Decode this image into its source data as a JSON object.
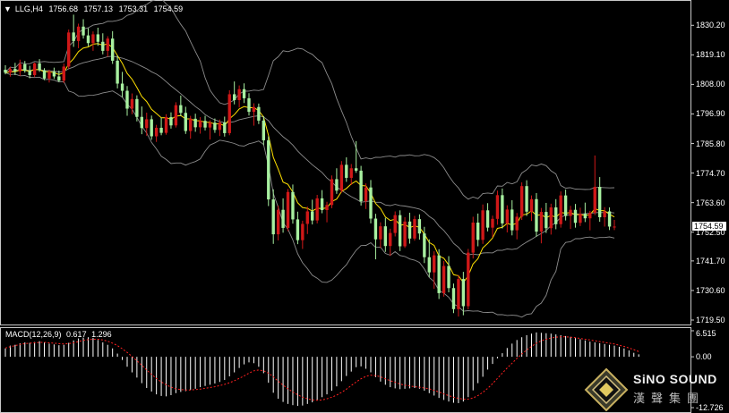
{
  "header": {
    "arrow": "▼",
    "symbol": "LLG,H4",
    "open": "1756.68",
    "high": "1757.13",
    "low": "1753.31",
    "close": "1754.59"
  },
  "price_axis": {
    "ticks": [
      "1830.20",
      "1819.10",
      "1808.00",
      "1796.90",
      "1785.80",
      "1774.70",
      "1763.60",
      "1752.50",
      "1741.70",
      "1730.60",
      "1719.50"
    ],
    "current_price": "1754.59"
  },
  "macd": {
    "label": "MACD(12,26,9)",
    "main": "0.617",
    "signal": "1.296",
    "ticks": [
      "6.515",
      "0.00",
      "-12.726"
    ]
  },
  "logo": {
    "name": "SiNO SOUND",
    "chinese": "漢聲集團"
  },
  "colors": {
    "bull": "#d01818",
    "bear": "#a8f0a0",
    "bands": "#8c8c8c",
    "ma": "#ffe000",
    "macd_hist": "#ffffff",
    "macd_signal": "#ff2020"
  },
  "chart_data": {
    "type": "candlestick",
    "symbol": "LLG",
    "timeframe": "H4",
    "ylim": [
      1719.5,
      1835
    ],
    "macd_ylim": [
      -12.726,
      6.515
    ],
    "candles": [
      [
        1813.5,
        1815.2,
        1811.8,
        1812.4
      ],
      [
        1812.4,
        1814.6,
        1810.9,
        1813.8
      ],
      [
        1813.8,
        1816.1,
        1811.5,
        1812.9
      ],
      [
        1812.9,
        1817.3,
        1811.2,
        1815.6
      ],
      [
        1815.6,
        1816.8,
        1812.4,
        1813.1
      ],
      [
        1813.1,
        1815.0,
        1810.3,
        1811.5
      ],
      [
        1811.5,
        1816.2,
        1810.8,
        1815.9
      ],
      [
        1815.9,
        1817.5,
        1812.7,
        1813.3
      ],
      [
        1813.3,
        1814.1,
        1809.6,
        1810.2
      ],
      [
        1810.2,
        1813.5,
        1808.7,
        1812.8
      ],
      [
        1812.8,
        1814.3,
        1810.1,
        1811.0
      ],
      [
        1811.0,
        1813.2,
        1808.9,
        1809.4
      ],
      [
        1809.4,
        1815.8,
        1808.5,
        1814.7
      ],
      [
        1814.7,
        1828.6,
        1813.9,
        1827.5
      ],
      [
        1827.5,
        1834.2,
        1822.1,
        1824.3
      ],
      [
        1824.3,
        1830.8,
        1821.6,
        1829.7
      ],
      [
        1829.7,
        1832.5,
        1825.2,
        1826.4
      ],
      [
        1826.4,
        1829.1,
        1822.3,
        1823.5
      ],
      [
        1823.5,
        1827.9,
        1820.6,
        1826.8
      ],
      [
        1826.8,
        1829.3,
        1822.5,
        1824.0
      ],
      [
        1824.0,
        1827.2,
        1819.3,
        1820.6
      ],
      [
        1820.6,
        1826.1,
        1818.4,
        1825.2
      ],
      [
        1825.2,
        1828.0,
        1815.7,
        1816.9
      ],
      [
        1816.9,
        1818.8,
        1806.5,
        1808.3
      ],
      [
        1808.3,
        1812.7,
        1803.2,
        1805.6
      ],
      [
        1805.6,
        1807.4,
        1796.2,
        1798.9
      ],
      [
        1798.9,
        1804.6,
        1796.8,
        1802.5
      ],
      [
        1802.5,
        1803.9,
        1794.1,
        1795.8
      ],
      [
        1795.8,
        1799.7,
        1789.3,
        1791.6
      ],
      [
        1791.6,
        1797.4,
        1788.7,
        1794.9
      ],
      [
        1794.9,
        1796.3,
        1787.2,
        1788.5
      ],
      [
        1788.5,
        1792.8,
        1786.4,
        1791.7
      ],
      [
        1791.7,
        1795.5,
        1788.9,
        1789.8
      ],
      [
        1789.8,
        1796.8,
        1789.1,
        1795.7
      ],
      [
        1795.7,
        1797.5,
        1791.4,
        1792.6
      ],
      [
        1792.6,
        1801.3,
        1791.8,
        1800.2
      ],
      [
        1800.2,
        1803.8,
        1796.1,
        1797.3
      ],
      [
        1797.3,
        1799.6,
        1789.4,
        1790.5
      ],
      [
        1790.5,
        1796.2,
        1787.6,
        1795.1
      ],
      [
        1795.1,
        1797.0,
        1790.2,
        1791.9
      ],
      [
        1791.9,
        1795.7,
        1789.5,
        1794.3
      ],
      [
        1794.3,
        1796.2,
        1790.7,
        1791.8
      ],
      [
        1791.8,
        1794.5,
        1787.3,
        1793.6
      ],
      [
        1793.6,
        1795.2,
        1789.8,
        1790.9
      ],
      [
        1790.9,
        1794.8,
        1788.6,
        1793.7
      ],
      [
        1793.7,
        1795.9,
        1788.4,
        1789.7
      ],
      [
        1789.7,
        1805.8,
        1788.9,
        1804.3
      ],
      [
        1804.3,
        1809.1,
        1800.5,
        1802.1
      ],
      [
        1802.1,
        1807.6,
        1799.3,
        1806.2
      ],
      [
        1806.2,
        1808.4,
        1801.0,
        1802.8
      ],
      [
        1802.8,
        1804.7,
        1796.3,
        1797.7
      ],
      [
        1797.7,
        1800.9,
        1792.5,
        1799.5
      ],
      [
        1799.5,
        1800.8,
        1793.1,
        1794.4
      ],
      [
        1794.4,
        1796.1,
        1785.2,
        1787.0
      ],
      [
        1787.0,
        1788.5,
        1762.3,
        1764.8
      ],
      [
        1764.8,
        1768.6,
        1748.1,
        1751.7
      ],
      [
        1751.7,
        1762.5,
        1749.4,
        1760.9
      ],
      [
        1760.9,
        1765.2,
        1752.3,
        1754.1
      ],
      [
        1754.1,
        1768.7,
        1752.9,
        1767.6
      ],
      [
        1767.6,
        1770.4,
        1755.7,
        1757.3
      ],
      [
        1757.3,
        1760.2,
        1748.0,
        1749.5
      ],
      [
        1749.5,
        1756.8,
        1746.2,
        1755.6
      ],
      [
        1755.6,
        1762.1,
        1751.8,
        1760.3
      ],
      [
        1760.3,
        1764.7,
        1755.4,
        1756.9
      ],
      [
        1756.9,
        1766.5,
        1755.8,
        1765.2
      ],
      [
        1765.2,
        1768.3,
        1759.6,
        1760.8
      ],
      [
        1760.8,
        1763.9,
        1756.2,
        1762.7
      ],
      [
        1762.7,
        1773.8,
        1761.5,
        1772.4
      ],
      [
        1772.4,
        1776.5,
        1766.9,
        1768.1
      ],
      [
        1768.1,
        1779.2,
        1767.3,
        1777.8
      ],
      [
        1777.8,
        1780.6,
        1771.4,
        1772.9
      ],
      [
        1772.9,
        1778.1,
        1770.2,
        1776.5
      ],
      [
        1776.5,
        1786.7,
        1774.8,
        1775.6
      ],
      [
        1775.6,
        1777.4,
        1762.5,
        1764.1
      ],
      [
        1764.1,
        1770.8,
        1761.2,
        1769.3
      ],
      [
        1769.3,
        1772.1,
        1755.8,
        1757.6
      ],
      [
        1757.6,
        1759.4,
        1742.3,
        1749.8
      ],
      [
        1749.8,
        1756.2,
        1746.5,
        1754.7
      ],
      [
        1754.7,
        1757.9,
        1745.1,
        1747.3
      ],
      [
        1747.3,
        1753.8,
        1743.6,
        1752.2
      ],
      [
        1752.2,
        1760.3,
        1750.9,
        1758.9
      ],
      [
        1758.9,
        1760.7,
        1745.4,
        1747.2
      ],
      [
        1747.2,
        1758.1,
        1746.6,
        1756.5
      ],
      [
        1756.5,
        1759.8,
        1748.2,
        1750.1
      ],
      [
        1750.1,
        1758.6,
        1749.3,
        1757.4
      ],
      [
        1757.4,
        1759.2,
        1749.7,
        1752.0
      ],
      [
        1752.0,
        1754.5,
        1740.9,
        1743.1
      ],
      [
        1743.1,
        1749.8,
        1735.6,
        1737.4
      ],
      [
        1737.4,
        1745.3,
        1731.2,
        1743.8
      ],
      [
        1743.8,
        1746.1,
        1727.4,
        1729.6
      ],
      [
        1729.6,
        1741.7,
        1728.3,
        1739.8
      ],
      [
        1739.8,
        1743.5,
        1729.9,
        1731.5
      ],
      [
        1731.5,
        1733.2,
        1722.1,
        1723.6
      ],
      [
        1723.6,
        1736.4,
        1720.8,
        1734.9
      ],
      [
        1734.9,
        1737.6,
        1721.3,
        1724.7
      ],
      [
        1724.7,
        1746.2,
        1723.5,
        1744.8
      ],
      [
        1744.8,
        1758.3,
        1742.6,
        1756.1
      ],
      [
        1756.1,
        1759.5,
        1747.2,
        1749.6
      ],
      [
        1749.6,
        1762.9,
        1748.1,
        1760.7
      ],
      [
        1760.7,
        1763.4,
        1752.8,
        1754.2
      ],
      [
        1754.2,
        1758.7,
        1750.6,
        1757.5
      ],
      [
        1757.5,
        1768.1,
        1755.3,
        1766.4
      ],
      [
        1766.4,
        1768.9,
        1753.9,
        1755.8
      ],
      [
        1755.8,
        1762.6,
        1752.4,
        1761.0
      ],
      [
        1761.0,
        1764.5,
        1751.3,
        1753.2
      ],
      [
        1753.2,
        1759.7,
        1749.8,
        1758.3
      ],
      [
        1758.3,
        1771.2,
        1757.1,
        1769.8
      ],
      [
        1769.8,
        1772.0,
        1758.6,
        1760.2
      ],
      [
        1760.2,
        1766.3,
        1756.7,
        1764.9
      ],
      [
        1764.9,
        1767.2,
        1750.8,
        1752.7
      ],
      [
        1752.7,
        1761.6,
        1748.3,
        1760.1
      ],
      [
        1760.1,
        1763.5,
        1752.2,
        1754.0
      ],
      [
        1754.0,
        1763.2,
        1751.6,
        1761.8
      ],
      [
        1761.8,
        1764.9,
        1753.6,
        1755.5
      ],
      [
        1755.5,
        1767.8,
        1754.2,
        1766.3
      ],
      [
        1766.3,
        1768.5,
        1756.9,
        1758.6
      ],
      [
        1758.6,
        1762.4,
        1753.7,
        1760.9
      ],
      [
        1760.9,
        1763.1,
        1754.2,
        1756.0
      ],
      [
        1756.0,
        1761.7,
        1754.8,
        1759.4
      ],
      [
        1759.4,
        1763.6,
        1756.3,
        1757.7
      ],
      [
        1757.7,
        1760.5,
        1753.2,
        1759.8
      ],
      [
        1759.8,
        1781.3,
        1758.9,
        1769.5
      ],
      [
        1769.5,
        1773.2,
        1756.4,
        1758.1
      ],
      [
        1758.1,
        1761.9,
        1754.6,
        1760.3
      ],
      [
        1760.3,
        1761.8,
        1753.3,
        1754.6
      ],
      [
        1754.6,
        1757.1,
        1753.3,
        1754.6
      ]
    ],
    "macd_hist": [
      2.1,
      2.8,
      3.0,
      3.4,
      3.6,
      3.5,
      3.7,
      3.9,
      3.6,
      3.3,
      3.1,
      2.9,
      3.0,
      3.5,
      4.1,
      4.6,
      4.8,
      4.9,
      4.7,
      4.2,
      3.6,
      3.0,
      2.1,
      0.8,
      -0.8,
      -2.5,
      -3.9,
      -5.2,
      -6.6,
      -7.8,
      -8.7,
      -9.4,
      -9.8,
      -9.9,
      -9.6,
      -9.1,
      -8.8,
      -8.6,
      -8.3,
      -8.0,
      -7.6,
      -7.3,
      -7.0,
      -6.7,
      -6.3,
      -5.8,
      -4.9,
      -3.9,
      -2.8,
      -1.9,
      -1.4,
      -1.6,
      -2.5,
      -4.1,
      -6.5,
      -9.0,
      -10.5,
      -11.3,
      -11.8,
      -12.1,
      -12.3,
      -12.2,
      -11.8,
      -11.4,
      -10.8,
      -10.1,
      -9.4,
      -8.5,
      -7.4,
      -6.1,
      -4.8,
      -3.7,
      -2.6,
      -2.4,
      -3.0,
      -3.9,
      -5.1,
      -6.2,
      -7.0,
      -7.6,
      -7.9,
      -8.1,
      -8.0,
      -7.9,
      -7.8,
      -8.0,
      -8.5,
      -9.1,
      -9.7,
      -10.3,
      -10.8,
      -11.2,
      -11.5,
      -11.6,
      -11.2,
      -10.1,
      -8.4,
      -6.6,
      -5.0,
      -3.2,
      -1.8,
      -0.4,
      0.9,
      2.2,
      3.3,
      4.2,
      4.9,
      5.4,
      5.8,
      6.1,
      6.0,
      5.9,
      5.8,
      5.6,
      5.4,
      5.2,
      5.0,
      4.7,
      4.4,
      4.1,
      3.8,
      3.6,
      3.4,
      3.2,
      3.0,
      2.8,
      2.5,
      2.1,
      1.6,
      1.0,
      0.617
    ],
    "macd_signal": [
      2.2,
      2.5,
      2.8,
      3.1,
      3.3,
      3.4,
      3.5,
      3.6,
      3.6,
      3.5,
      3.4,
      3.3,
      3.2,
      3.3,
      3.5,
      3.8,
      4.1,
      4.3,
      4.4,
      4.4,
      4.2,
      3.9,
      3.4,
      2.8,
      2.0,
      1.1,
      0.1,
      -1.0,
      -2.1,
      -3.3,
      -4.4,
      -5.4,
      -6.3,
      -7.0,
      -7.6,
      -8.0,
      -8.2,
      -8.3,
      -8.3,
      -8.2,
      -8.1,
      -7.9,
      -7.7,
      -7.5,
      -7.2,
      -6.9,
      -6.5,
      -6.0,
      -5.4,
      -4.8,
      -4.1,
      -3.5,
      -3.3,
      -3.5,
      -4.1,
      -5.0,
      -6.1,
      -7.1,
      -8.0,
      -8.8,
      -9.5,
      -10.1,
      -10.5,
      -10.8,
      -10.9,
      -10.8,
      -10.5,
      -10.1,
      -9.6,
      -8.9,
      -8.1,
      -7.2,
      -6.3,
      -5.5,
      -4.9,
      -4.6,
      -4.7,
      -5.0,
      -5.5,
      -6.0,
      -6.4,
      -6.8,
      -7.1,
      -7.3,
      -7.5,
      -7.6,
      -7.8,
      -8.0,
      -8.4,
      -8.8,
      -9.3,
      -9.7,
      -10.1,
      -10.4,
      -10.6,
      -10.6,
      -10.3,
      -9.7,
      -8.9,
      -7.9,
      -6.7,
      -5.4,
      -4.1,
      -2.8,
      -1.6,
      -0.4,
      0.7,
      1.7,
      2.6,
      3.4,
      4.0,
      4.4,
      4.7,
      4.9,
      5.0,
      5.0,
      4.9,
      4.8,
      4.6,
      4.4,
      4.2,
      4.0,
      3.8,
      3.6,
      3.4,
      3.2,
      2.9,
      2.6,
      2.2,
      1.8,
      1.296
    ]
  }
}
